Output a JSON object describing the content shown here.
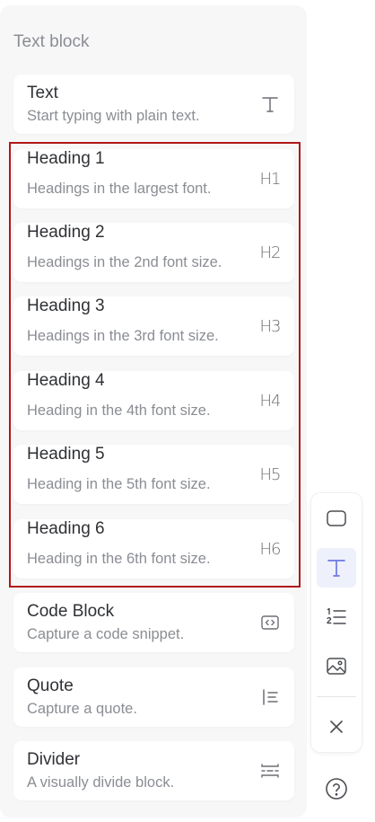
{
  "panel": {
    "section_title": "Text block",
    "items": [
      {
        "title": "Text",
        "desc": "Start typing with plain text.",
        "icon": "text-icon"
      },
      {
        "title": "Heading 1",
        "desc": "Headings in the largest font.",
        "icon": "h1-icon",
        "icon_text": "H1"
      },
      {
        "title": "Heading 2",
        "desc": "Headings in the 2nd font size.",
        "icon": "h2-icon",
        "icon_text": "H2"
      },
      {
        "title": "Heading 3",
        "desc": "Headings in the 3rd font size.",
        "icon": "h3-icon",
        "icon_text": "H3"
      },
      {
        "title": "Heading 4",
        "desc": "Heading in the 4th font size.",
        "icon": "h4-icon",
        "icon_text": "H4"
      },
      {
        "title": "Heading 5",
        "desc": "Heading in the 5th font size.",
        "icon": "h5-icon",
        "icon_text": "H5"
      },
      {
        "title": "Heading 6",
        "desc": "Heading in the 6th font size.",
        "icon": "h6-icon",
        "icon_text": "H6"
      },
      {
        "title": "Code Block",
        "desc": "Capture a code snippet.",
        "icon": "code-icon"
      },
      {
        "title": "Quote",
        "desc": "Capture a quote.",
        "icon": "quote-icon"
      },
      {
        "title": "Divider",
        "desc": "A visually divide block.",
        "icon": "divider-icon"
      }
    ]
  },
  "toolbar": {
    "tools": [
      "square-icon",
      "text-icon",
      "numbered-list-icon",
      "image-icon",
      "close-icon"
    ],
    "active": "text-icon"
  },
  "help": {
    "icon": "help-icon"
  },
  "colors": {
    "highlight": "#b01818",
    "accent": "#6b78e5",
    "panel_bg": "#f7f7f8"
  }
}
